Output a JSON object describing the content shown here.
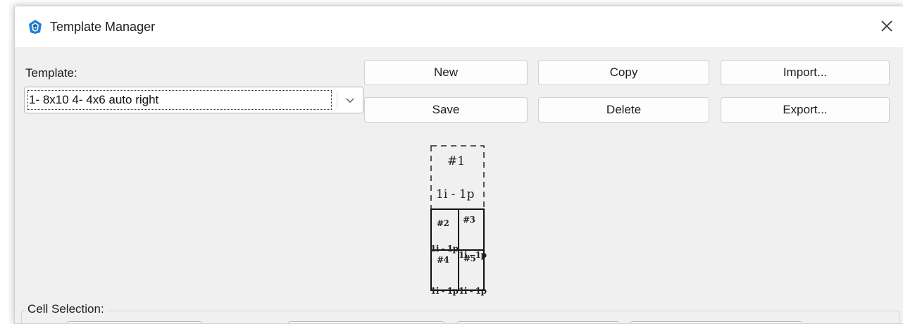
{
  "window": {
    "title": "Template Manager",
    "app_icon": "template-manager-app-icon",
    "close_icon": "close-icon"
  },
  "template": {
    "label": "Template:",
    "selected_value": "1- 8x10 4- 4x6 auto right",
    "dropdown_icon": "chevron-down-icon"
  },
  "buttons": {
    "new": "New",
    "copy": "Copy",
    "import": "Import...",
    "save": "Save",
    "delete": "Delete",
    "export": "Export..."
  },
  "preview": {
    "cells": [
      {
        "label": "#1",
        "info": "1i - 1p"
      },
      {
        "label": "#2",
        "info": "1i - 1p"
      },
      {
        "label": "#3",
        "info": "1i - 1p"
      },
      {
        "label": "#4",
        "info": "1i - 1p"
      },
      {
        "label": "#5",
        "info": "1i - 1p"
      }
    ]
  },
  "cell_selection": {
    "label": "Cell Selection:"
  },
  "colors": {
    "window_background": "#f0f0f0",
    "titlebar_background": "#ffffff",
    "button_background": "#fdfdfd",
    "accent_icon": "#1f7fd6"
  }
}
